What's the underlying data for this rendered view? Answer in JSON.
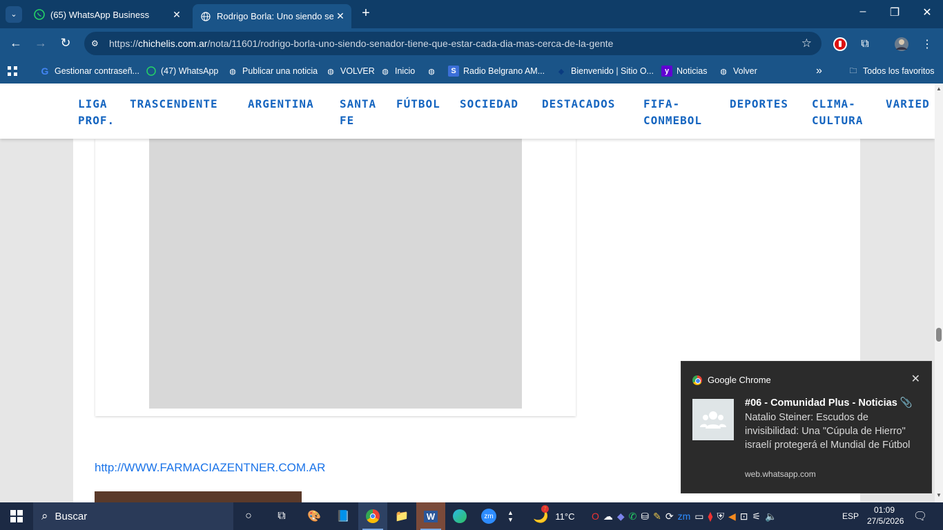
{
  "browser": {
    "tabs": [
      {
        "label": "(65) WhatsApp Business",
        "icon": "whatsapp-icon",
        "active": false
      },
      {
        "label": "Rodrigo Borla: Uno siendo sena",
        "icon": "globe-icon",
        "active": true
      }
    ],
    "new_tab": "+",
    "window_controls": {
      "minimize": "–",
      "maximize": "❐",
      "close": "✕"
    },
    "url_prefix": "https://",
    "url_domain": "chichelis.com.ar",
    "url_path": "/nota/11601/rodrigo-borla-uno-siendo-senador-tiene-que-estar-cada-dia-mas-cerca-de-la-gente",
    "bookmarks": [
      {
        "label": "Gestionar contraseñ...",
        "icon": "google-icon"
      },
      {
        "label": "(47) WhatsApp",
        "icon": "whatsapp-icon"
      },
      {
        "label": "Publicar una noticia",
        "icon": "globe-icon"
      },
      {
        "label": "VOLVER",
        "icon": "globe-icon"
      },
      {
        "label": "Inicio",
        "icon": "globe-icon"
      },
      {
        "label": "",
        "icon": "globe-icon"
      },
      {
        "label": "Radio Belgrano AM...",
        "icon": "s-icon"
      },
      {
        "label": "Bienvenido | Sitio O...",
        "icon": "shield-icon"
      },
      {
        "label": "Noticias",
        "icon": "yahoo-icon"
      },
      {
        "label": "Volver",
        "icon": "globe-icon"
      }
    ],
    "more_bookmarks": "»",
    "all_favorites": "Todos los favoritos"
  },
  "site": {
    "menu": [
      "LIGA PROF.",
      "TRASCENDENTE",
      "ARGENTINA",
      "SANTA FE",
      "FÚTBOL",
      "SOCIEDAD",
      "DESTACADOS",
      "FIFA-CONMEBOL",
      "DEPORTES",
      "CLIMA-CULTURA",
      "VARIED"
    ],
    "menu_lines": [
      [
        "LIGA",
        "PROF."
      ],
      [
        "TRASCENDENTE"
      ],
      [
        "ARGENTINA"
      ],
      [
        "SANTA",
        "FE"
      ],
      [
        "FÚTBOL"
      ],
      [
        "SOCIEDAD"
      ],
      [
        "DESTACADOS"
      ],
      [
        "FIFA-",
        "CONMEBOL"
      ],
      [
        "DEPORTES"
      ],
      [
        "CLIMA-",
        "CULTURA"
      ],
      [
        "VARIED"
      ]
    ],
    "link": "http://WWW.FARMACIAZENTNER.COM.AR"
  },
  "notification": {
    "app": "Google Chrome",
    "title": "#06 - Comunidad Plus - Noticias 📎",
    "body": "Natalio Steiner: Escudos de invisibilidad: Una \"Cúpula de Hierro\" israelí protegerá el Mundial de Fútbol",
    "source": "web.whatsapp.com",
    "close": "✕"
  },
  "taskbar": {
    "search_placeholder": "Buscar",
    "weather": "11°C",
    "weather_badge": "7",
    "language": "ESP",
    "time": "01:09",
    "date": "27/5/2026"
  }
}
